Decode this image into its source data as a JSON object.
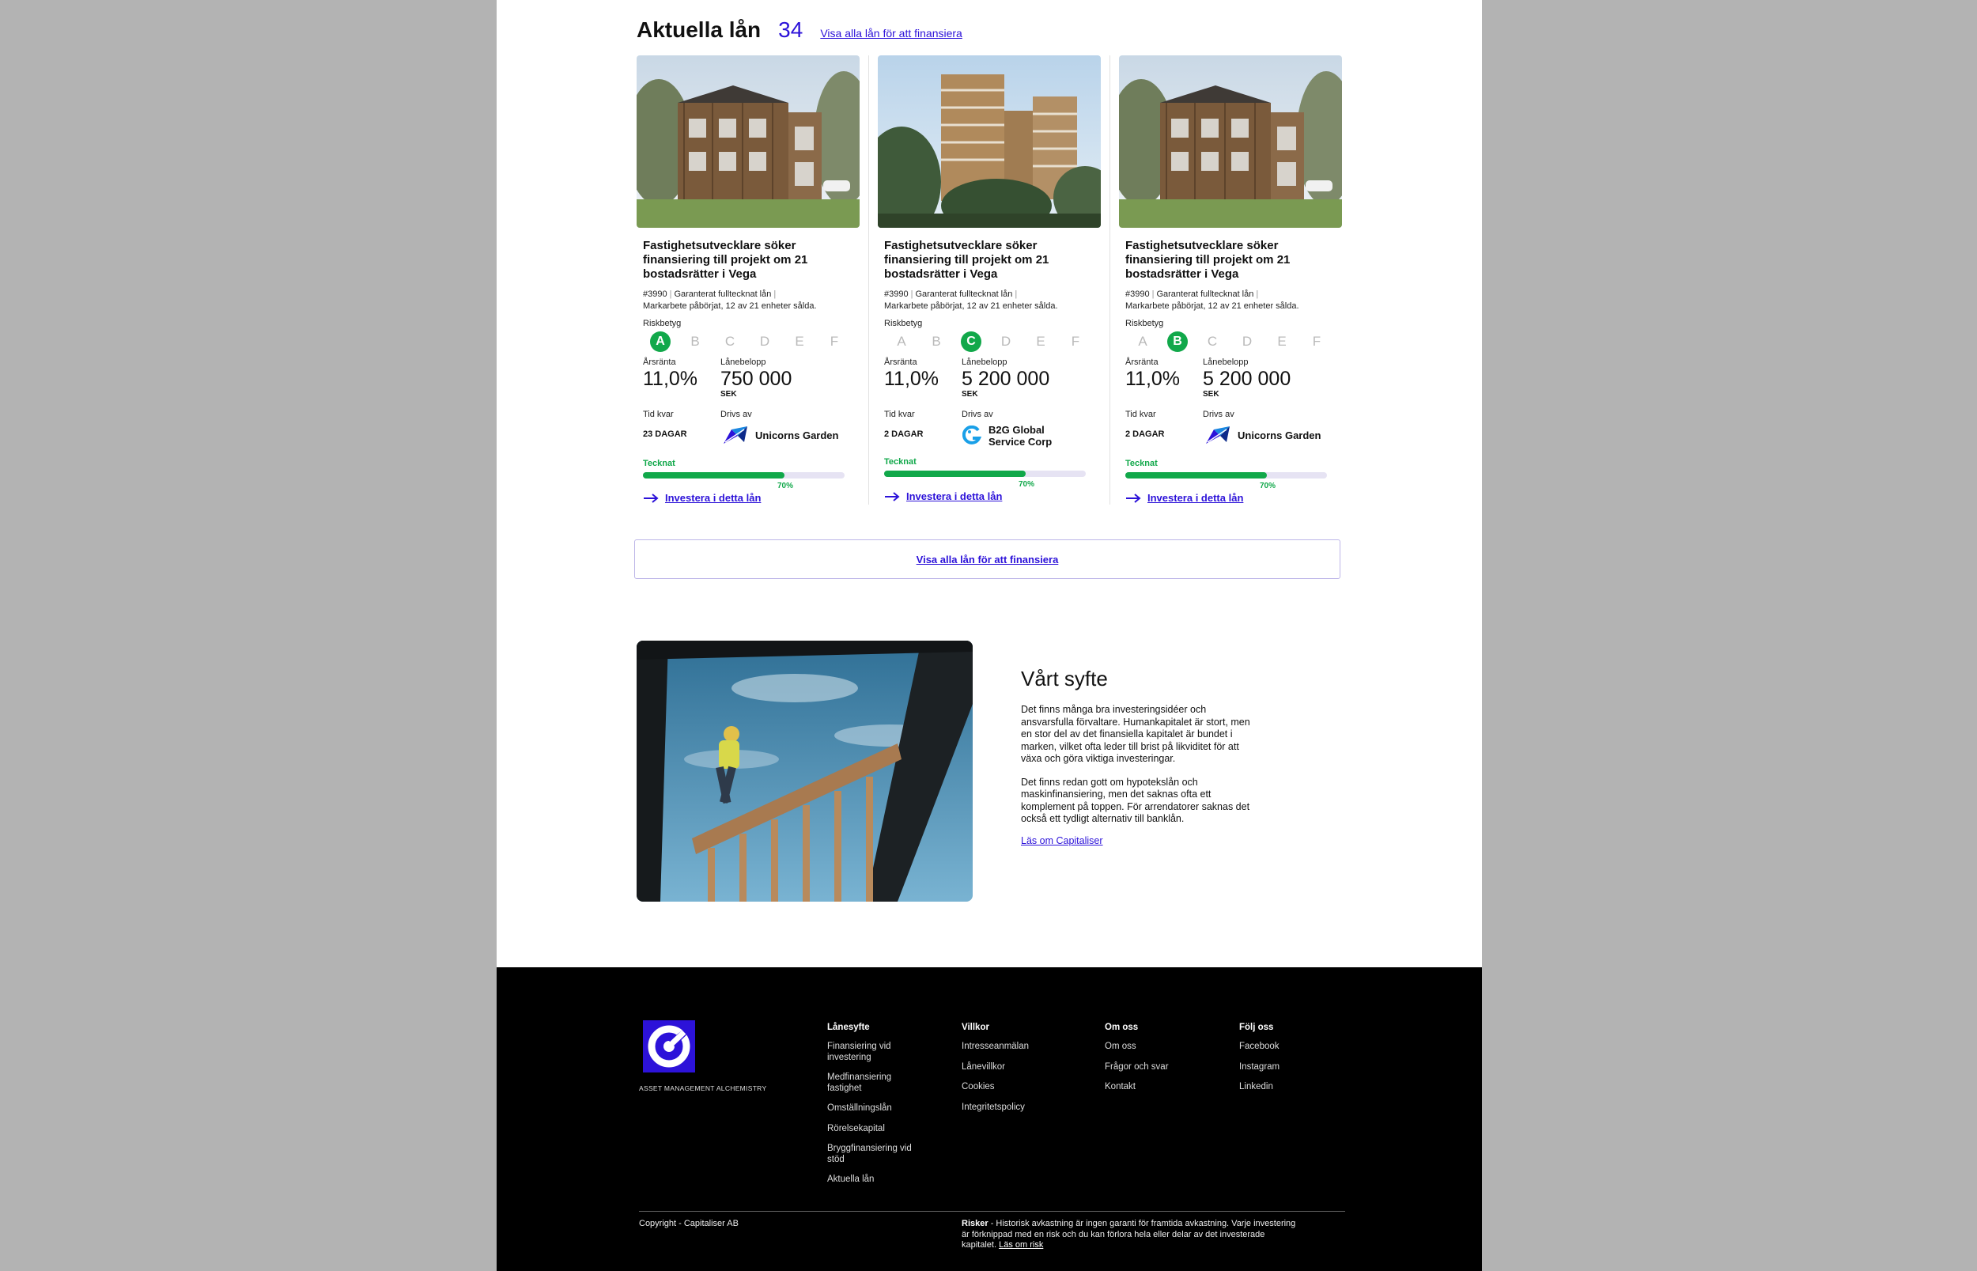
{
  "loans": {
    "title": "Aktuella lån",
    "count": "34",
    "view_all_link": "Visa alla lån för att finansiera",
    "labels": {
      "risk": "Riskbetyg",
      "rate": "Årsränta",
      "amount": "Lånebelopp",
      "unit": "SEK",
      "time_left": "Tid kvar",
      "run_by": "Drivs av",
      "subscribed": "Tecknat",
      "invest": "Investera i detta lån"
    },
    "grades": [
      "A",
      "B",
      "C",
      "D",
      "E",
      "F"
    ],
    "cards": [
      {
        "title": "Fastighetsutvecklare söker finansiering till projekt om 21 bostadsrätter i Vega",
        "id": "#3990",
        "tag": "Garanterat fulltecknat lån",
        "note": "Markarbete påbörjat, 12 av 21 enheter sålda.",
        "active_grade": "A",
        "rate": "11,0%",
        "amount": "750 000",
        "time_left": "23 DAGAR",
        "company": "Unicorns Garden",
        "progress": 70,
        "progress_label": "70%"
      },
      {
        "title": "Fastighetsutvecklare söker finansiering till projekt om 21 bostadsrätter i Vega",
        "id": "#3990",
        "tag": "Garanterat fulltecknat lån",
        "note": "Markarbete påbörjat, 12 av 21 enheter sålda.",
        "active_grade": "C",
        "rate": "11,0%",
        "amount": "5 200 000",
        "time_left": "2 DAGAR",
        "company": "B2G Global Service Corp",
        "progress": 70,
        "progress_label": "70%"
      },
      {
        "title": "Fastighetsutvecklare söker finansiering till projekt om 21 bostadsrätter i Vega",
        "id": "#3990",
        "tag": "Garanterat fulltecknat lån",
        "note": "Markarbete påbörjat, 12 av 21 enheter sålda.",
        "active_grade": "B",
        "rate": "11,0%",
        "amount": "5 200 000",
        "time_left": "2 DAGAR",
        "company": "Unicorns Garden",
        "progress": 70,
        "progress_label": "70%"
      }
    ],
    "all_button": "Visa alla lån för att finansiera"
  },
  "purpose": {
    "title": "Vårt syfte",
    "p1": "Det finns många bra investeringsidéer och ansvarsfulla förvaltare. Humankapitalet är stort, men en stor del av det finansiella kapitalet är bundet i marken, vilket ofta leder till brist på likviditet för att växa och göra viktiga investeringar.",
    "p2": "Det finns redan gott om hypotekslån och maskinfinansiering, men det saknas ofta ett komplement på toppen. För arrendatorer saknas det också ett tydligt alternativ till banklån.",
    "link": "Läs om Capitaliser"
  },
  "footer": {
    "tagline": "ASSET MANAGEMENT  ALCHEMISTRY",
    "columns": [
      {
        "title": "Lånesyfte",
        "items": [
          "Finansiering vid investering",
          "Medfinansiering fastighet",
          "Omställningslån",
          "Rörelsekapital",
          "Bryggfinansiering vid stöd",
          "Aktuella lån"
        ]
      },
      {
        "title": "Villkor",
        "items": [
          "Intresseanmälan",
          "Lånevillkor",
          "Cookies",
          "Integritetspolicy"
        ]
      },
      {
        "title": "Om oss",
        "items": [
          "Om oss",
          "Frågor och svar",
          "Kontakt"
        ]
      },
      {
        "title": "Följ oss",
        "items": [
          "Facebook",
          "Instagram",
          "Linkedin"
        ]
      }
    ],
    "copyright": "Copyright - Capitaliser  AB",
    "risk_title": "Risker",
    "risk_text": " - Historisk avkastning är ingen garanti för framtida avkastning. Varje investering är förknippad med en risk och du kan förlora hela eller delar av det investerade kapitalet. ",
    "risk_link": "Läs om risk"
  },
  "colors": {
    "accent": "#2c12d9",
    "success": "#11a84a",
    "footer_bg": "#000000",
    "page_bg": "#b3b3b3"
  }
}
